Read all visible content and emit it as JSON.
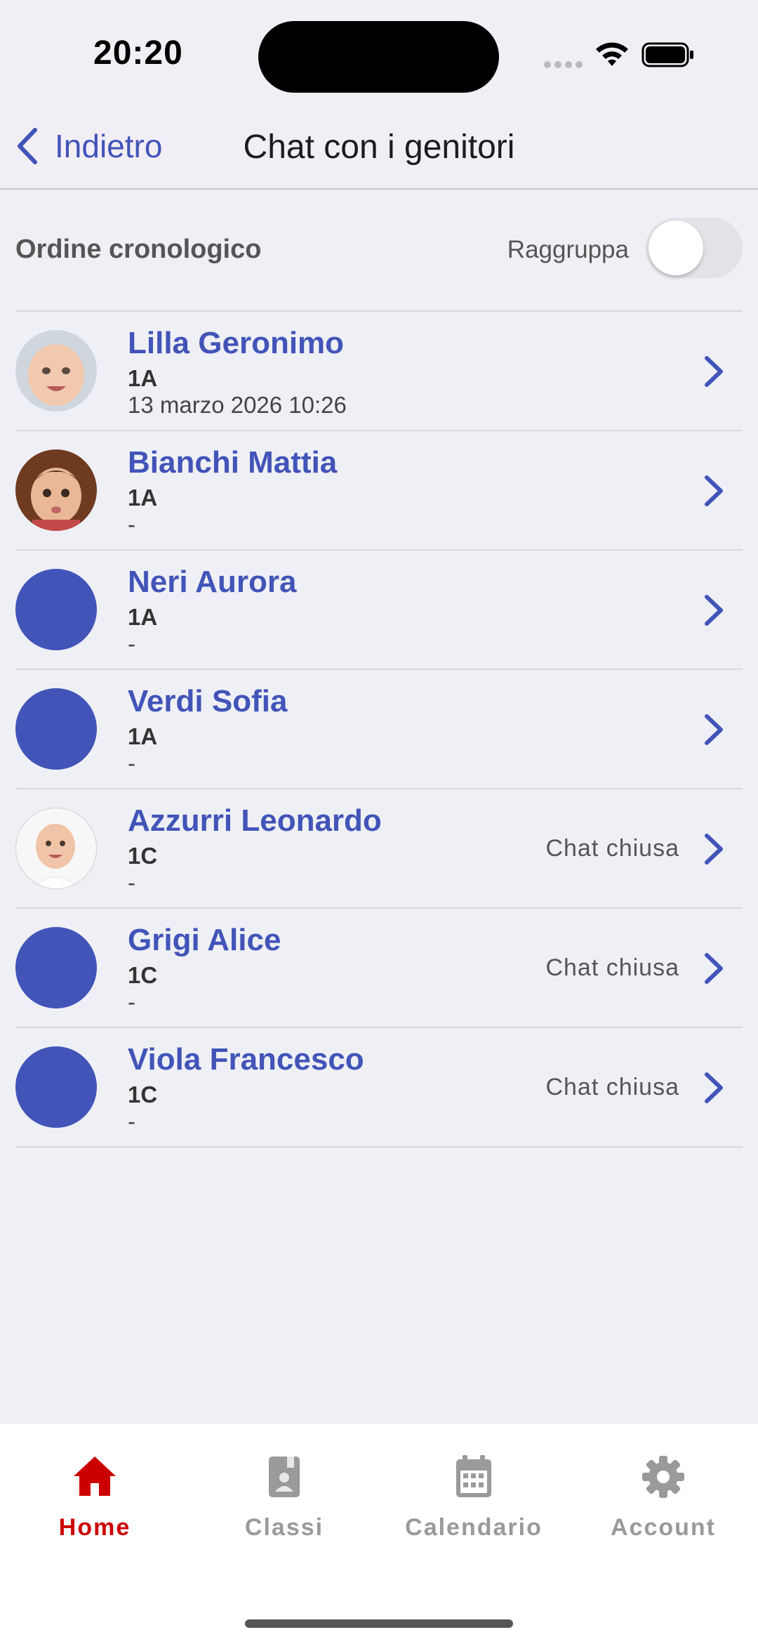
{
  "status_bar": {
    "time": "20:20"
  },
  "nav": {
    "back_label": "Indietro",
    "title": "Chat con i genitori"
  },
  "sort": {
    "label": "Ordine cronologico",
    "group_label": "Raggruppa",
    "group_enabled": false
  },
  "chats": [
    {
      "name": "Lilla Geronimo",
      "class": "1A",
      "last": "13 marzo 2026 10:26",
      "status": "",
      "avatar": "baby-photo"
    },
    {
      "name": "Bianchi Mattia",
      "class": "1A",
      "last": "-",
      "status": "",
      "avatar": "toddler-photo"
    },
    {
      "name": "Neri Aurora",
      "class": "1A",
      "last": "-",
      "status": "",
      "avatar": "placeholder"
    },
    {
      "name": "Verdi Sofia",
      "class": "1A",
      "last": "-",
      "status": "",
      "avatar": "placeholder"
    },
    {
      "name": "Azzurri Leonardo",
      "class": "1C",
      "last": "-",
      "status": "Chat chiusa",
      "avatar": "baby-white-photo"
    },
    {
      "name": "Grigi Alice",
      "class": "1C",
      "last": "-",
      "status": "Chat chiusa",
      "avatar": "placeholder"
    },
    {
      "name": "Viola Francesco",
      "class": "1C",
      "last": "-",
      "status": "Chat chiusa",
      "avatar": "placeholder"
    }
  ],
  "tabs": [
    {
      "label": "Home",
      "icon": "home-icon",
      "active": true
    },
    {
      "label": "Classi",
      "icon": "class-book-icon",
      "active": false
    },
    {
      "label": "Calendario",
      "icon": "calendar-icon",
      "active": false
    },
    {
      "label": "Account",
      "icon": "gear-icon",
      "active": false
    }
  ],
  "colors": {
    "accent": "#4254b8",
    "active_tab": "#cc0000",
    "inactive_tab": "#9a9a9a",
    "background": "#eef0f5"
  }
}
